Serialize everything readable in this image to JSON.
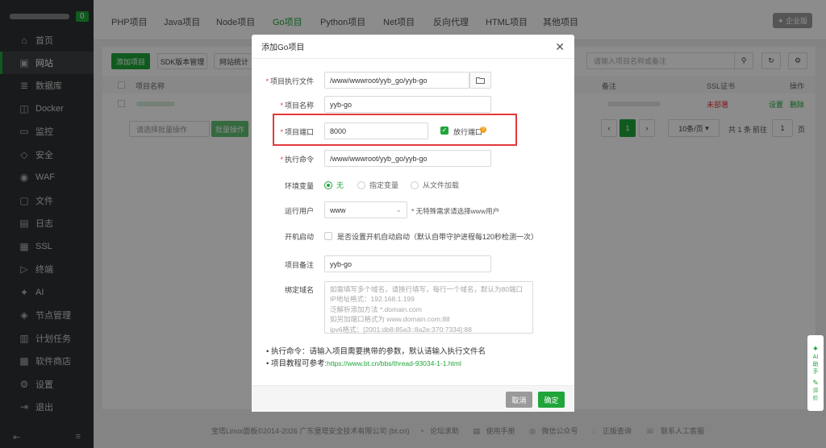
{
  "sidebar": {
    "badge": "0",
    "items": [
      {
        "label": "首页",
        "icon": "home-icon",
        "glyph": "⌂"
      },
      {
        "label": "网站",
        "icon": "globe-icon",
        "glyph": "▣"
      },
      {
        "label": "数据库",
        "icon": "database-icon",
        "glyph": "≣"
      },
      {
        "label": "Docker",
        "icon": "docker-icon",
        "glyph": "◫"
      },
      {
        "label": "监控",
        "icon": "monitor-icon",
        "glyph": "▭"
      },
      {
        "label": "安全",
        "icon": "shield-icon",
        "glyph": "◇"
      },
      {
        "label": "WAF",
        "icon": "waf-icon",
        "glyph": "◉"
      },
      {
        "label": "文件",
        "icon": "folder-icon",
        "glyph": "▢"
      },
      {
        "label": "日志",
        "icon": "log-icon",
        "glyph": "▤"
      },
      {
        "label": "SSL",
        "icon": "ssl-icon",
        "glyph": "▦"
      },
      {
        "label": "终端",
        "icon": "terminal-icon",
        "glyph": "▷"
      },
      {
        "label": "AI",
        "icon": "ai-icon",
        "glyph": "✦"
      },
      {
        "label": "节点管理",
        "icon": "node-icon",
        "glyph": "◈"
      },
      {
        "label": "计划任务",
        "icon": "cron-icon",
        "glyph": "▥"
      },
      {
        "label": "软件商店",
        "icon": "store-icon",
        "glyph": "▩"
      },
      {
        "label": "设置",
        "icon": "gear-icon",
        "glyph": "⚙"
      },
      {
        "label": "退出",
        "icon": "logout-icon",
        "glyph": "⇥"
      }
    ],
    "active_index": 1
  },
  "tabs": [
    "PHP项目",
    "Java项目",
    "Node项目",
    "Go项目",
    "Python项目",
    "Net项目",
    "反向代理",
    "HTML项目",
    "其他项目"
  ],
  "active_tab": 3,
  "enterprise_label": "企业版",
  "toolbar": {
    "add_project": "添加项目",
    "sdk_manage": "SDK版本管理",
    "site_stats": "网站统计",
    "search_placeholder": "请输入项目名称或备注"
  },
  "table": {
    "headers": {
      "name": "项目名称",
      "note": "备注",
      "ssl": "SSL证书",
      "action": "操作"
    },
    "row": {
      "ssl": "未部署",
      "settings": "设置",
      "delete": "删除"
    },
    "batch_placeholder": "请选择批量操作",
    "batch_button": "批量操作",
    "pager": {
      "page": "1",
      "per_page": "10条/页",
      "total": "共 1 条",
      "goto": "前往",
      "goto_page": "1",
      "page_unit": "页"
    }
  },
  "footer": [
    "宝塔Linux面板©2014-2026 广东堡塔安全技术有限公司 (bt.cn)",
    "论坛求助",
    "使用手册",
    "微信公众号",
    "正版查询",
    "联系人工客服"
  ],
  "dialog": {
    "title": "添加Go项目",
    "fields": {
      "exec_file_label": "项目执行文件",
      "exec_file_value": "/www/wwwroot/yyb_go/yyb-go",
      "name_label": "项目名称",
      "name_value": "yyb-go",
      "port_label": "项目端口",
      "port_value": "8000",
      "open_port_label": "放行端口",
      "command_label": "执行命令",
      "command_value": "/www/wwwroot/yyb_go/yyb-go",
      "env_label": "环境变量",
      "env_options": [
        "无",
        "指定变量",
        "从文件加载"
      ],
      "env_selected": 0,
      "user_label": "运行用户",
      "user_value": "www",
      "user_hint": "* 无特殊需求请选择www用户",
      "autostart_label": "开机启动",
      "autostart_text": "是否设置开机自动启动（默认自带守护进程每120秒检测一次）",
      "remark_label": "项目备注",
      "remark_value": "yyb-go",
      "domain_label": "绑定域名",
      "domain_placeholder": [
        "如需填写多个域名，请换行填写，每行一个域名，默认为80端口",
        "IP地址格式：192.168.1.199",
        "泛解析添加方法 *.domain.com",
        "如另加端口格式为 www.domain.com:88",
        "ipv6格式：[2001:db8:85a3::8a2e:370:7334]:88"
      ]
    },
    "tips": {
      "cmd_tip": "执行命令：请输入项目需要携带的参数，默认请输入执行文件名",
      "tutorial_prefix": "项目教程可参考:",
      "tutorial_link": "https://www.bt.cn/bbs/thread-93034-1-1.html"
    },
    "cancel": "取消",
    "confirm": "确定"
  },
  "float_tab": {
    "ai": "AI助手",
    "rate": "评价"
  },
  "colors": {
    "accent": "#20a53a",
    "danger": "#e4393c",
    "sidebar_bg": "#2f3133"
  }
}
